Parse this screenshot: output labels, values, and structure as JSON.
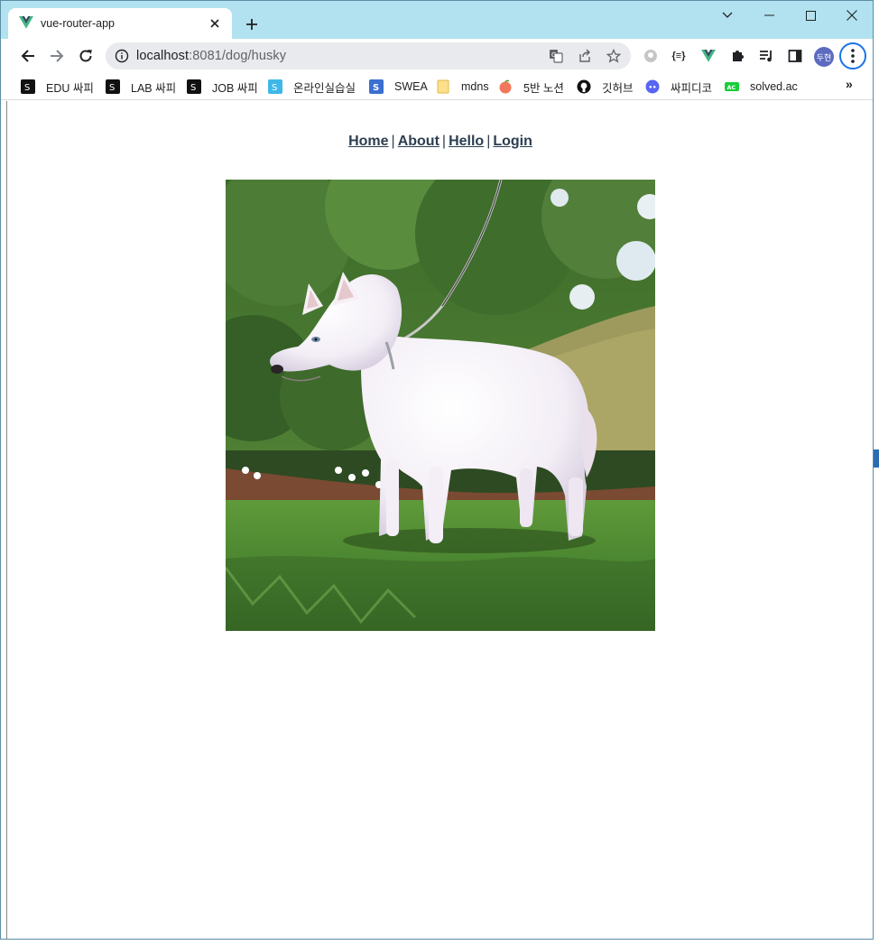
{
  "browser": {
    "tab": {
      "title": "vue-router-app",
      "favicon": "vue-logo-icon"
    },
    "url": {
      "host": "localhost",
      "rest": ":8081/dog/husky"
    },
    "profile_initials": "두현",
    "ext_json_label": "{≡}"
  },
  "bookmarks": [
    {
      "label": "EDU 싸피",
      "icon": "ssafy-icon"
    },
    {
      "label": "LAB 싸피",
      "icon": "ssafy-icon"
    },
    {
      "label": "JOB 싸피",
      "icon": "ssafy-icon"
    },
    {
      "label": "온라인실습실",
      "icon": "ssafy-blue-icon"
    },
    {
      "label": "SWEA",
      "icon": "swea-icon"
    },
    {
      "label": "mdns",
      "icon": "folder-icon"
    },
    {
      "label": "5반 노션",
      "icon": "peach-icon"
    },
    {
      "label": "깃허브",
      "icon": "github-icon"
    },
    {
      "label": "싸피디코",
      "icon": "discord-icon"
    },
    {
      "label": "solved.ac",
      "icon": "solvedac-icon"
    }
  ],
  "nav": {
    "home": "Home",
    "about": "About",
    "hello": "Hello",
    "login": "Login",
    "separator": "|"
  },
  "image": {
    "alt": "white siberian husky on a leash in a garden"
  },
  "colors": {
    "tabstrip": "#b2e2ef",
    "link": "#2c3e50",
    "accent": "#1a73e8",
    "vue_green": "#41b883",
    "vue_dark": "#35495e"
  }
}
